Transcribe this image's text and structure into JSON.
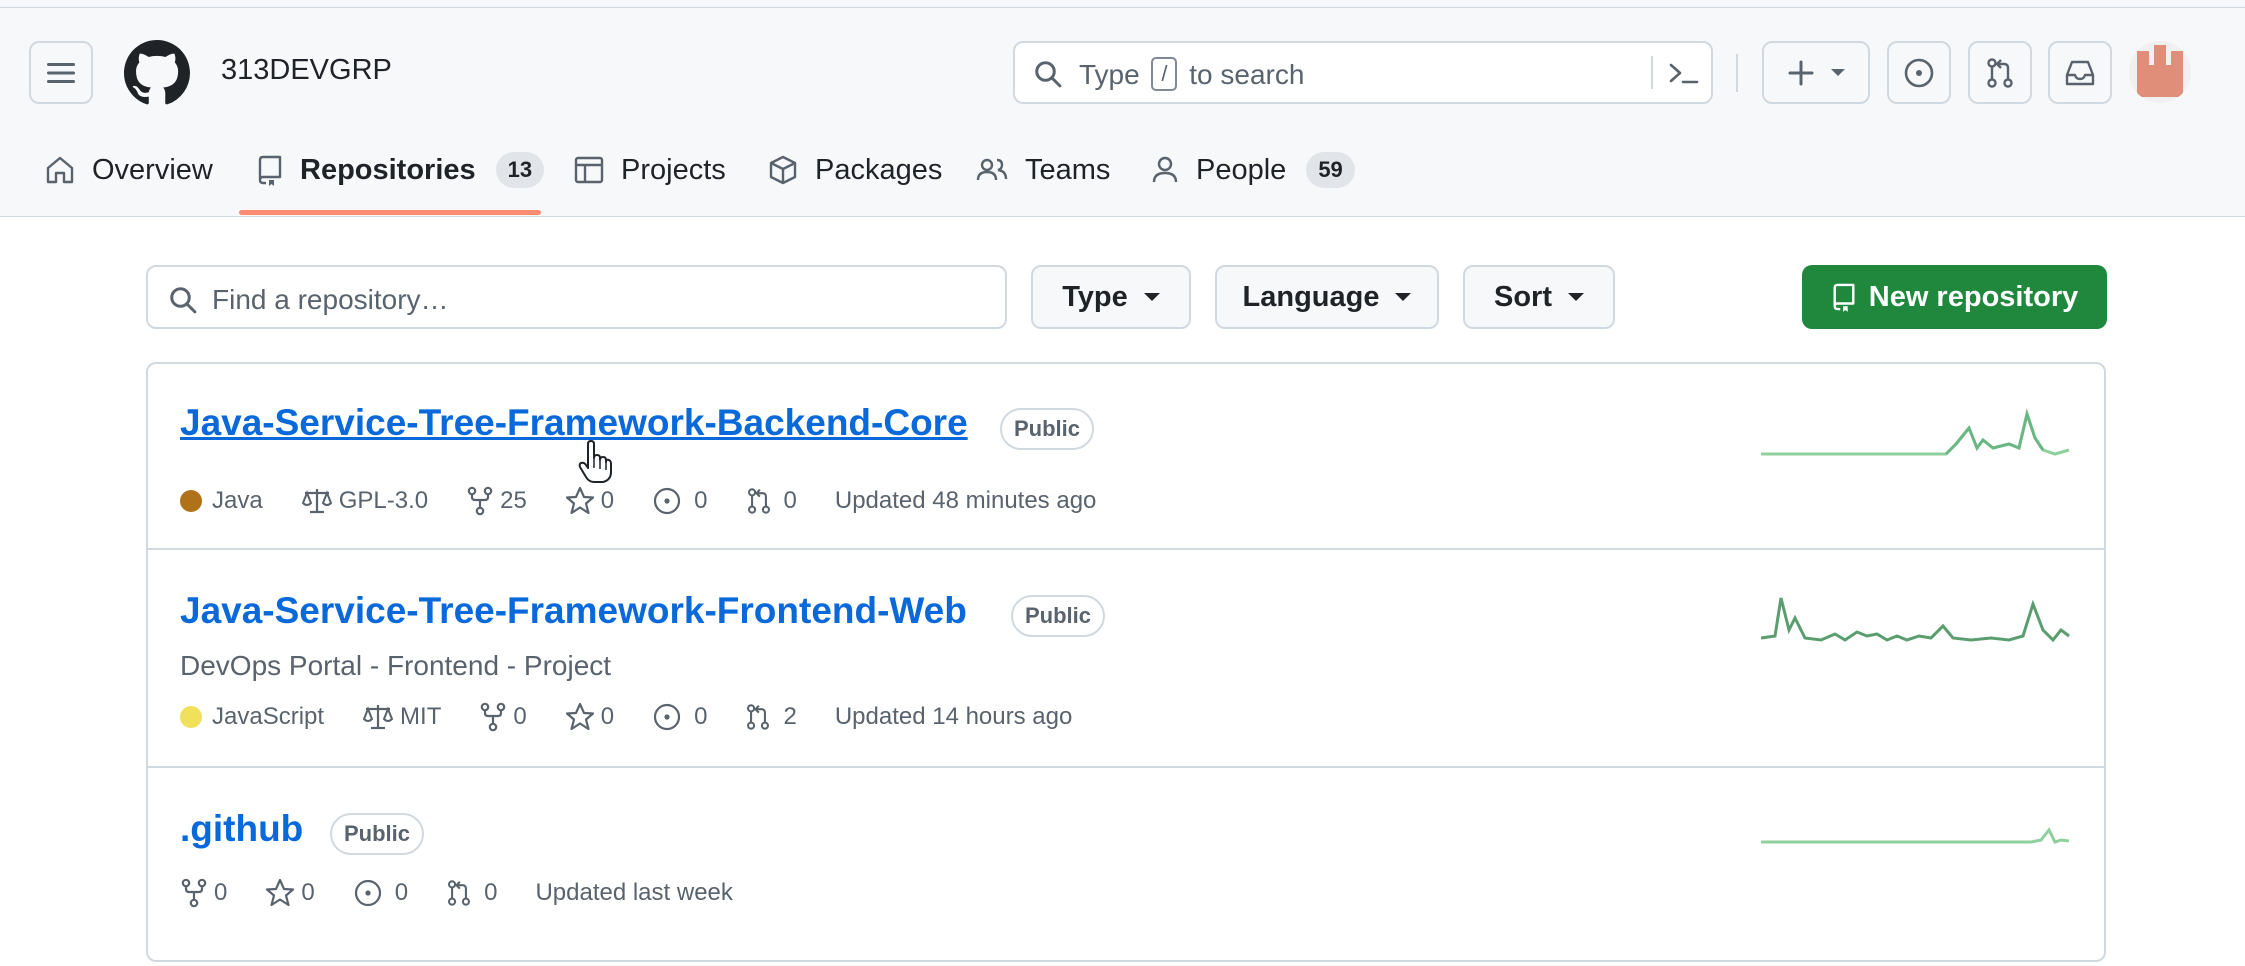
{
  "header": {
    "org_name": "313DEVGRP",
    "search_placeholder_before": "Type",
    "search_placeholder_key": "/",
    "search_placeholder_after": "to search"
  },
  "tabs": [
    {
      "label": "Overview",
      "icon": "home-icon"
    },
    {
      "label": "Repositories",
      "icon": "repo-icon",
      "count": "13",
      "selected": true
    },
    {
      "label": "Projects",
      "icon": "table-icon"
    },
    {
      "label": "Packages",
      "icon": "package-icon"
    },
    {
      "label": "Teams",
      "icon": "people-icon"
    },
    {
      "label": "People",
      "icon": "person-icon",
      "count": "59"
    }
  ],
  "filters": {
    "search_placeholder": "Find a repository…",
    "type_label": "Type",
    "language_label": "Language",
    "sort_label": "Sort",
    "new_repo_label": "New repository"
  },
  "repos": [
    {
      "name": "Java-Service-Tree-Framework-Backend-Core",
      "visibility": "Public",
      "description": "",
      "language": "Java",
      "language_color": "#b07219",
      "license": "GPL-3.0",
      "forks": "25",
      "stars": "0",
      "issues": "0",
      "pulls": "0",
      "updated": "Updated 48 minutes ago"
    },
    {
      "name": "Java-Service-Tree-Framework-Frontend-Web",
      "visibility": "Public",
      "description": "DevOps Portal - Frontend - Project",
      "language": "JavaScript",
      "language_color": "#f1e05a",
      "license": "MIT",
      "forks": "0",
      "stars": "0",
      "issues": "0",
      "pulls": "2",
      "updated": "Updated 14 hours ago"
    },
    {
      "name": ".github",
      "visibility": "Public",
      "description": "",
      "forks": "0",
      "stars": "0",
      "issues": "0",
      "pulls": "0",
      "updated": "Updated last week"
    }
  ],
  "colors": {
    "link": "#0969da",
    "primary_button": "#1f883d",
    "tab_underline": "#fd8c73",
    "spark_light": "#8fd19e",
    "spark_dark": "#5a9e6f"
  }
}
